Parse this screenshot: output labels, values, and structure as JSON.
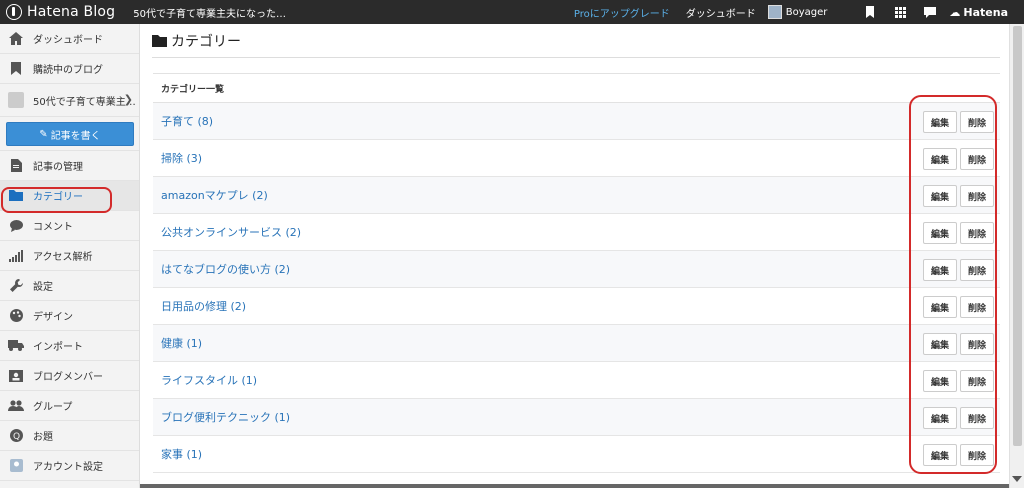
{
  "topbar": {
    "brand": "Hatena Blog",
    "blog_title": "50代で子育て専業主夫になった…",
    "pro_link": "Proにアップグレード",
    "dashboard": "ダッシュボード",
    "user_name": "Boyager",
    "hatena": "Hatena",
    "hatena_mark": "☁"
  },
  "sidebar": {
    "dashboard": "ダッシュボード",
    "subscriptions": "購読中のブログ",
    "blog_name": "50代で子育て専業主…",
    "write": "記事を書く",
    "entries": "記事の管理",
    "category": "カテゴリー",
    "comment": "コメント",
    "access": "アクセス解析",
    "settings": "設定",
    "design": "デザイン",
    "import": "インポート",
    "members": "ブログメンバー",
    "group": "グループ",
    "theme": "お題",
    "account": "アカウント設定"
  },
  "main": {
    "title": "カテゴリー",
    "list_header": "カテゴリー一覧",
    "edit_label": "編集",
    "delete_label": "削除",
    "categories": [
      "子育て (8)",
      "掃除 (3)",
      "amazonマケプレ (2)",
      "公共オンラインサービス (2)",
      "はてなブログの使い方 (2)",
      "日用品の修理 (2)",
      "健康 (1)",
      "ライフスタイル (1)",
      "ブログ便利テクニック (1)",
      "家事 (1)"
    ]
  },
  "colors": {
    "topbar": "#2b2b2b",
    "link": "#2873b8",
    "write_button": "#3b8fd6",
    "highlight": "#d32a2a"
  }
}
